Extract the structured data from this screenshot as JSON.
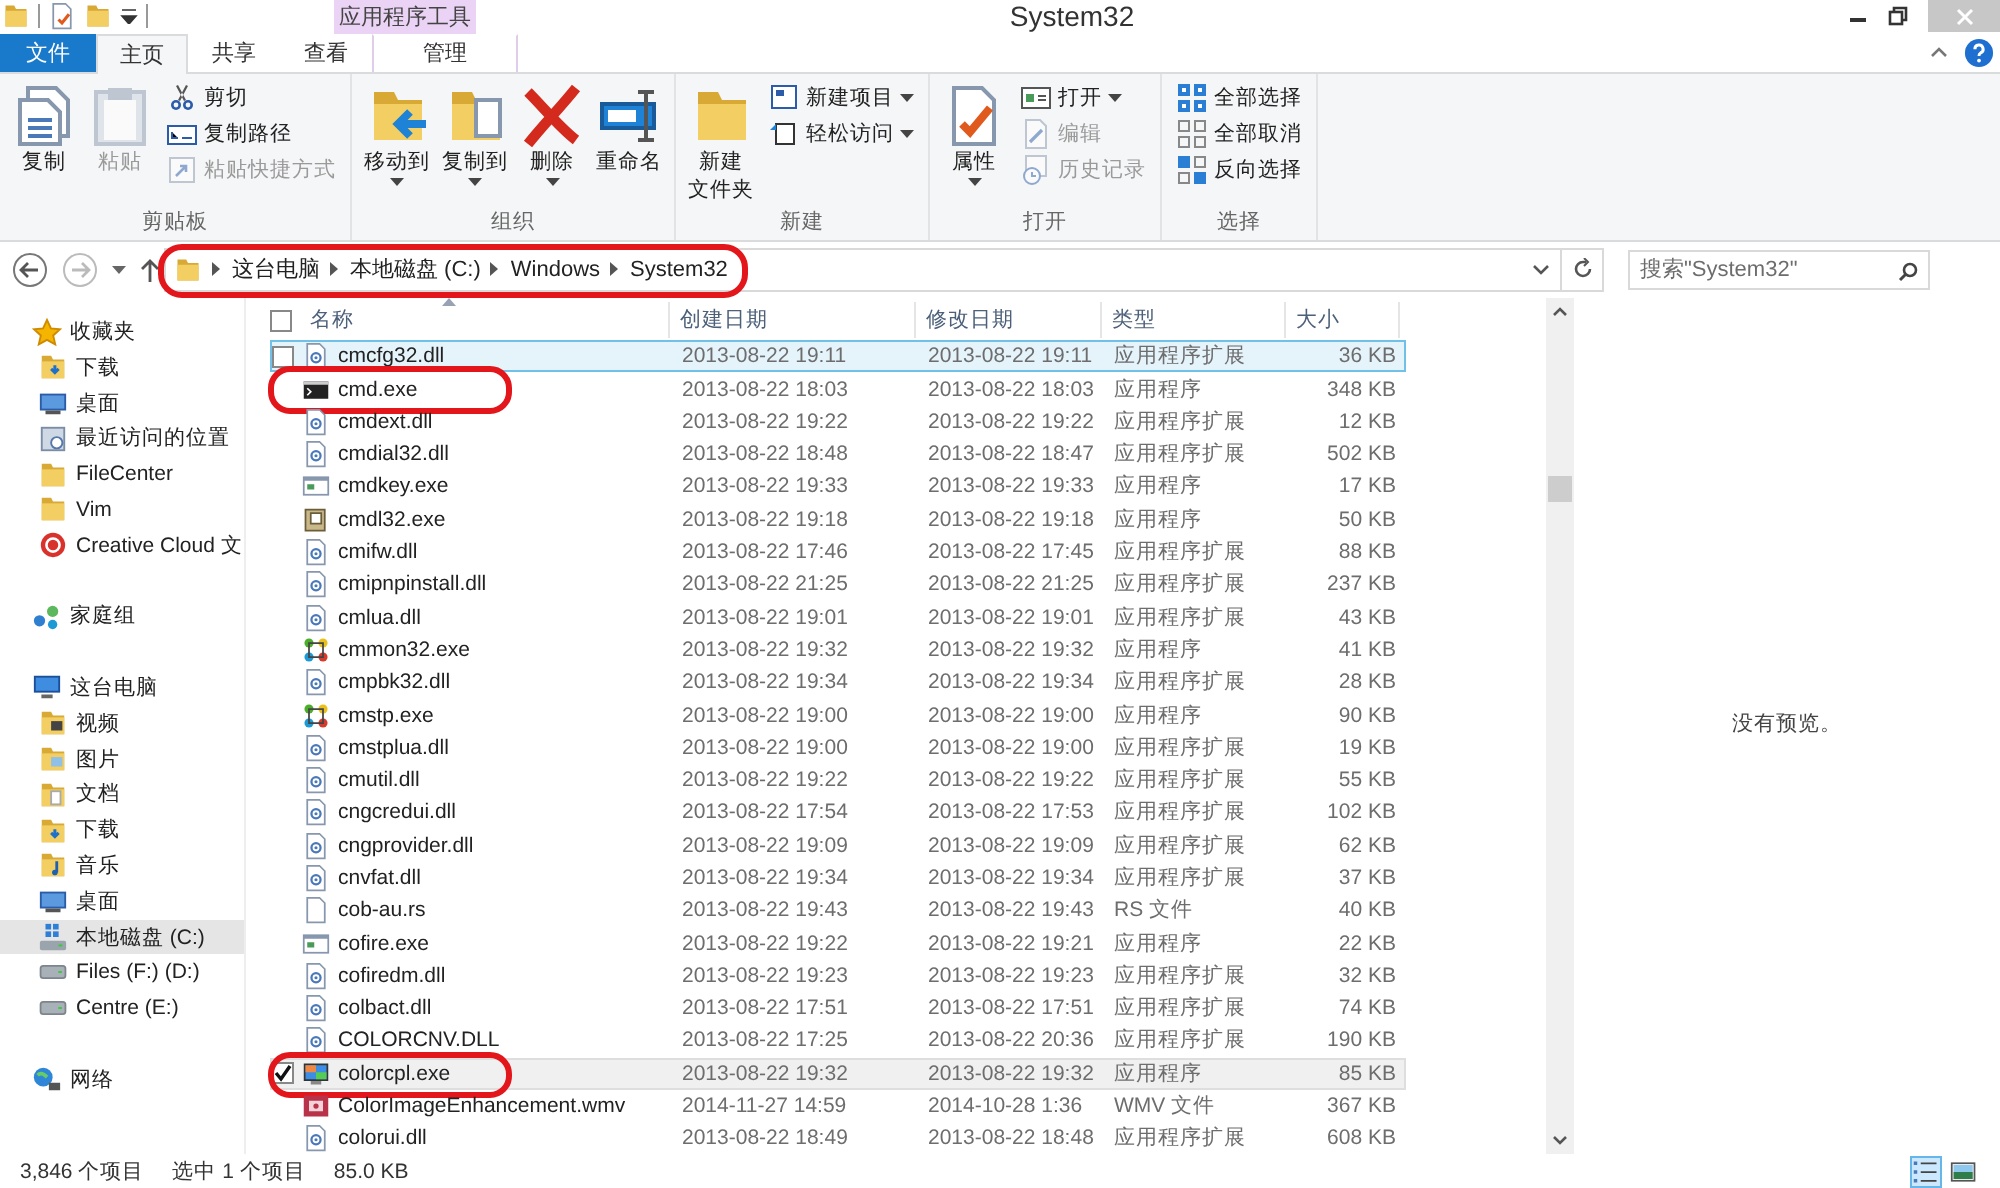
{
  "window": {
    "title": "System32"
  },
  "ribbon": {
    "contextual_header": "应用程序工具",
    "tabs": [
      {
        "label": "文件",
        "kind": "file",
        "selected": false
      },
      {
        "label": "主页",
        "kind": "tab",
        "selected": true
      },
      {
        "label": "共享",
        "kind": "tab",
        "selected": false
      },
      {
        "label": "查看",
        "kind": "tab",
        "selected": false
      },
      {
        "label": "管理",
        "kind": "contextual",
        "selected": false
      }
    ],
    "groups": [
      {
        "label": "剪贴板",
        "items": [
          {
            "label": "复制",
            "kind": "large",
            "disabled": false,
            "dropdown": false
          },
          {
            "label": "粘贴",
            "kind": "large",
            "disabled": true,
            "dropdown": false
          },
          {
            "label": "剪切",
            "kind": "small",
            "disabled": false,
            "dropdown": false
          },
          {
            "label": "复制路径",
            "kind": "small",
            "disabled": false,
            "dropdown": false
          },
          {
            "label": "粘贴快捷方式",
            "kind": "small",
            "disabled": true,
            "dropdown": false
          }
        ]
      },
      {
        "label": "组织",
        "items": [
          {
            "label": "移动到",
            "kind": "large",
            "disabled": false,
            "dropdown": true
          },
          {
            "label": "复制到",
            "kind": "large",
            "disabled": false,
            "dropdown": true
          },
          {
            "label": "删除",
            "kind": "large",
            "disabled": false,
            "dropdown": true
          },
          {
            "label": "重命名",
            "kind": "large",
            "disabled": false,
            "dropdown": false
          }
        ]
      },
      {
        "label": "新建",
        "items": [
          {
            "label": [
              "新建",
              "文件夹"
            ],
            "kind": "large",
            "disabled": false,
            "dropdown": false
          },
          {
            "label": "新建项目",
            "kind": "small",
            "disabled": false,
            "dropdown": true
          },
          {
            "label": "轻松访问",
            "kind": "small",
            "disabled": false,
            "dropdown": true
          }
        ]
      },
      {
        "label": "打开",
        "items": [
          {
            "label": "属性",
            "kind": "large",
            "disabled": false,
            "dropdown": true
          },
          {
            "label": "打开",
            "kind": "small",
            "disabled": false,
            "dropdown": true
          },
          {
            "label": "编辑",
            "kind": "small",
            "disabled": true,
            "dropdown": false
          },
          {
            "label": "历史记录",
            "kind": "small",
            "disabled": true,
            "dropdown": false
          }
        ]
      },
      {
        "label": "选择",
        "items": [
          {
            "label": "全部选择",
            "kind": "small",
            "disabled": false,
            "dropdown": false
          },
          {
            "label": "全部取消",
            "kind": "small",
            "disabled": false,
            "dropdown": false
          },
          {
            "label": "反向选择",
            "kind": "small",
            "disabled": false,
            "dropdown": false
          }
        ]
      }
    ]
  },
  "address": {
    "segments": [
      "这台电脑",
      "本地磁盘 (C:)",
      "Windows",
      "System32"
    ],
    "circled": true
  },
  "search": {
    "placeholder": "搜索\"System32\""
  },
  "nav": [
    {
      "label": "收藏夹",
      "kind": "favorites",
      "selected": false,
      "children": [
        {
          "label": "下载",
          "kind": "downloads",
          "selected": false
        },
        {
          "label": "桌面",
          "kind": "desktop",
          "selected": false
        },
        {
          "label": "最近访问的位置",
          "kind": "recent",
          "selected": false
        },
        {
          "label": "FileCenter",
          "kind": "folder",
          "selected": false
        },
        {
          "label": "Vim",
          "kind": "folder",
          "selected": false
        },
        {
          "label": "Creative Cloud 文",
          "kind": "cloud",
          "selected": false
        }
      ]
    },
    {
      "label": "家庭组",
      "kind": "homegroup",
      "selected": false
    },
    {
      "label": "这台电脑",
      "kind": "computer",
      "selected": false,
      "children": [
        {
          "label": "视频",
          "kind": "videos",
          "selected": false
        },
        {
          "label": "图片",
          "kind": "pictures",
          "selected": false
        },
        {
          "label": "文档",
          "kind": "documents",
          "selected": false
        },
        {
          "label": "下载",
          "kind": "downloads",
          "selected": false
        },
        {
          "label": "音乐",
          "kind": "music",
          "selected": false
        },
        {
          "label": "桌面",
          "kind": "desktop",
          "selected": false
        },
        {
          "label": "本地磁盘 (C:)",
          "kind": "system-drive",
          "selected": true
        },
        {
          "label": "Files (F:) (D:)",
          "kind": "drive",
          "selected": false
        },
        {
          "label": "Centre (E:)",
          "kind": "drive",
          "selected": false
        }
      ]
    },
    {
      "label": "网络",
      "kind": "network",
      "selected": false
    }
  ],
  "file_list": {
    "select_all_checked": false,
    "columns": [
      "名称",
      "创建日期",
      "修改日期",
      "类型",
      "大小"
    ],
    "rows": [
      {
        "name": "cmcfg32.dll",
        "created": "2013-08-22 19:11",
        "modified": "2013-08-22 19:11",
        "type": "应用程序扩展",
        "size": "36 KB",
        "kind": "dll",
        "selected": false,
        "hovered": true,
        "circled": false
      },
      {
        "name": "cmd.exe",
        "created": "2013-08-22 18:03",
        "modified": "2013-08-22 18:03",
        "type": "应用程序",
        "size": "348 KB",
        "kind": "console",
        "selected": false,
        "hovered": false,
        "circled": true
      },
      {
        "name": "cmdext.dll",
        "created": "2013-08-22 19:22",
        "modified": "2013-08-22 19:22",
        "type": "应用程序扩展",
        "size": "12 KB",
        "kind": "dll",
        "selected": false,
        "hovered": false,
        "circled": false
      },
      {
        "name": "cmdial32.dll",
        "created": "2013-08-22 18:48",
        "modified": "2013-08-22 18:47",
        "type": "应用程序扩展",
        "size": "502 KB",
        "kind": "dll",
        "selected": false,
        "hovered": false,
        "circled": false
      },
      {
        "name": "cmdkey.exe",
        "created": "2013-08-22 19:33",
        "modified": "2013-08-22 19:33",
        "type": "应用程序",
        "size": "17 KB",
        "kind": "app",
        "selected": false,
        "hovered": false,
        "circled": false
      },
      {
        "name": "cmdl32.exe",
        "created": "2013-08-22 19:18",
        "modified": "2013-08-22 19:18",
        "type": "应用程序",
        "size": "50 KB",
        "kind": "book",
        "selected": false,
        "hovered": false,
        "circled": false
      },
      {
        "name": "cmifw.dll",
        "created": "2013-08-22 17:46",
        "modified": "2013-08-22 17:45",
        "type": "应用程序扩展",
        "size": "88 KB",
        "kind": "dll",
        "selected": false,
        "hovered": false,
        "circled": false
      },
      {
        "name": "cmipnpinstall.dll",
        "created": "2013-08-22 21:25",
        "modified": "2013-08-22 21:25",
        "type": "应用程序扩展",
        "size": "237 KB",
        "kind": "dll",
        "selected": false,
        "hovered": false,
        "circled": false
      },
      {
        "name": "cmlua.dll",
        "created": "2013-08-22 19:01",
        "modified": "2013-08-22 19:01",
        "type": "应用程序扩展",
        "size": "43 KB",
        "kind": "dll",
        "selected": false,
        "hovered": false,
        "circled": false
      },
      {
        "name": "cmmon32.exe",
        "created": "2013-08-22 19:32",
        "modified": "2013-08-22 19:32",
        "type": "应用程序",
        "size": "41 KB",
        "kind": "nodes",
        "selected": false,
        "hovered": false,
        "circled": false
      },
      {
        "name": "cmpbk32.dll",
        "created": "2013-08-22 19:34",
        "modified": "2013-08-22 19:34",
        "type": "应用程序扩展",
        "size": "28 KB",
        "kind": "dll",
        "selected": false,
        "hovered": false,
        "circled": false
      },
      {
        "name": "cmstp.exe",
        "created": "2013-08-22 19:00",
        "modified": "2013-08-22 19:00",
        "type": "应用程序",
        "size": "90 KB",
        "kind": "nodes",
        "selected": false,
        "hovered": false,
        "circled": false
      },
      {
        "name": "cmstplua.dll",
        "created": "2013-08-22 19:00",
        "modified": "2013-08-22 19:00",
        "type": "应用程序扩展",
        "size": "19 KB",
        "kind": "dll",
        "selected": false,
        "hovered": false,
        "circled": false
      },
      {
        "name": "cmutil.dll",
        "created": "2013-08-22 19:22",
        "modified": "2013-08-22 19:22",
        "type": "应用程序扩展",
        "size": "55 KB",
        "kind": "dll",
        "selected": false,
        "hovered": false,
        "circled": false
      },
      {
        "name": "cngcredui.dll",
        "created": "2013-08-22 17:54",
        "modified": "2013-08-22 17:53",
        "type": "应用程序扩展",
        "size": "102 KB",
        "kind": "dll",
        "selected": false,
        "hovered": false,
        "circled": false
      },
      {
        "name": "cngprovider.dll",
        "created": "2013-08-22 19:09",
        "modified": "2013-08-22 19:09",
        "type": "应用程序扩展",
        "size": "62 KB",
        "kind": "dll",
        "selected": false,
        "hovered": false,
        "circled": false
      },
      {
        "name": "cnvfat.dll",
        "created": "2013-08-22 19:34",
        "modified": "2013-08-22 19:34",
        "type": "应用程序扩展",
        "size": "37 KB",
        "kind": "dll",
        "selected": false,
        "hovered": false,
        "circled": false
      },
      {
        "name": "cob-au.rs",
        "created": "2013-08-22 19:43",
        "modified": "2013-08-22 19:43",
        "type": "RS 文件",
        "size": "40 KB",
        "kind": "blank",
        "selected": false,
        "hovered": false,
        "circled": false
      },
      {
        "name": "cofire.exe",
        "created": "2013-08-22 19:22",
        "modified": "2013-08-22 19:21",
        "type": "应用程序",
        "size": "22 KB",
        "kind": "app",
        "selected": false,
        "hovered": false,
        "circled": false
      },
      {
        "name": "cofiredm.dll",
        "created": "2013-08-22 19:23",
        "modified": "2013-08-22 19:23",
        "type": "应用程序扩展",
        "size": "32 KB",
        "kind": "dll",
        "selected": false,
        "hovered": false,
        "circled": false
      },
      {
        "name": "colbact.dll",
        "created": "2013-08-22 17:51",
        "modified": "2013-08-22 17:51",
        "type": "应用程序扩展",
        "size": "74 KB",
        "kind": "dll",
        "selected": false,
        "hovered": false,
        "circled": false
      },
      {
        "name": "COLORCNV.DLL",
        "created": "2013-08-22 17:25",
        "modified": "2013-08-22 20:36",
        "type": "应用程序扩展",
        "size": "190 KB",
        "kind": "dll",
        "selected": false,
        "hovered": false,
        "circled": false
      },
      {
        "name": "colorcpl.exe",
        "created": "2013-08-22 19:32",
        "modified": "2013-08-22 19:32",
        "type": "应用程序",
        "size": "85 KB",
        "kind": "monitor",
        "selected": true,
        "hovered": false,
        "circled": true
      },
      {
        "name": "ColorImageEnhancement.wmv",
        "created": "2014-11-27 14:59",
        "modified": "2014-10-28 1:36",
        "type": "WMV 文件",
        "size": "367 KB",
        "kind": "video",
        "selected": false,
        "hovered": false,
        "circled": false
      },
      {
        "name": "colorui.dll",
        "created": "2013-08-22 18:49",
        "modified": "2013-08-22 18:48",
        "type": "应用程序扩展",
        "size": "608 KB",
        "kind": "dll",
        "selected": false,
        "hovered": false,
        "circled": false
      }
    ]
  },
  "preview": {
    "message": "没有预览。"
  },
  "status_bar": {
    "item_count": "3,846 个项目",
    "selection": "选中 1 个项目",
    "selection_size": "85.0 KB",
    "views": [
      {
        "kind": "details",
        "selected": true
      },
      {
        "kind": "large-icons",
        "selected": false
      }
    ]
  }
}
